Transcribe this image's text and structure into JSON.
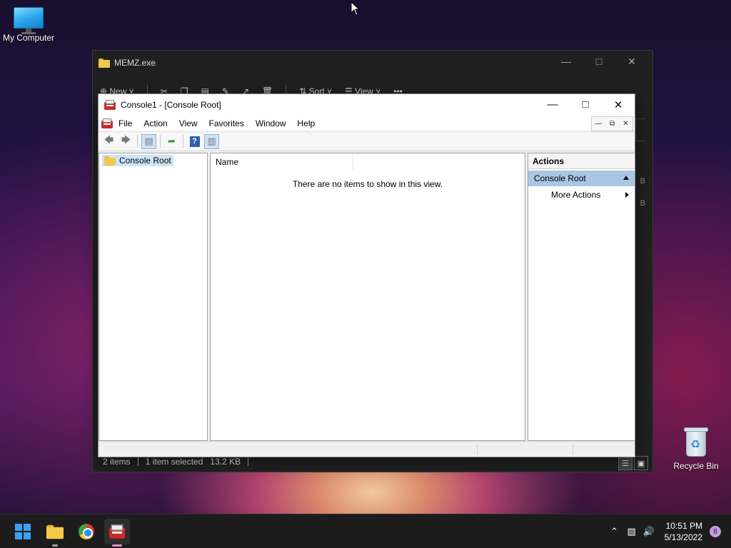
{
  "desktop": {
    "icons": [
      {
        "label": "My Computer"
      },
      {
        "label": "Recycle Bin"
      }
    ]
  },
  "explorer": {
    "title": "MEMZ.exe",
    "cmd": {
      "new": "New",
      "sort": "Sort",
      "view": "View",
      "more": "•••"
    },
    "status": {
      "items": "2 items",
      "selected": "1 item selected",
      "size": "13.2 KB"
    },
    "ghost_b1": "B",
    "ghost_b2": "B"
  },
  "mmc": {
    "title": "Console1 - [Console Root]",
    "menu": [
      "File",
      "Action",
      "View",
      "Favorites",
      "Window",
      "Help"
    ],
    "tree_root": "Console Root",
    "list_header": "Name",
    "empty_message": "There are no items to show in this view.",
    "actions": {
      "header": "Actions",
      "section": "Console Root",
      "item": "More Actions"
    }
  },
  "taskbar": {
    "time": "10:51 PM",
    "date": "5/13/2022",
    "notifications": "8"
  },
  "colors": {
    "selection": "#cce4f7",
    "action_section": "#a9c6e4",
    "taskbar": "#1c1c1c"
  }
}
